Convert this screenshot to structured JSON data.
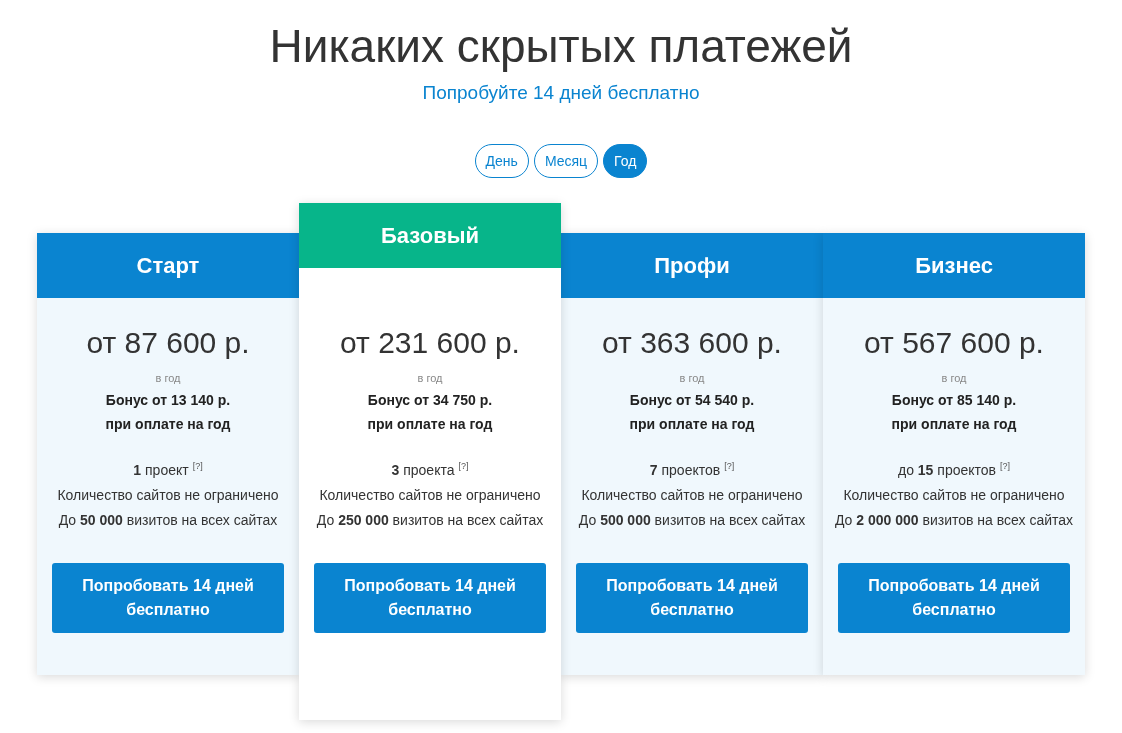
{
  "heading": "Никаких скрытых платежей",
  "subheading": "Попробуйте 14 дней бесплатно",
  "periods": [
    {
      "label": "День",
      "selected": false
    },
    {
      "label": "Месяц",
      "selected": false
    },
    {
      "label": "Год",
      "selected": true
    }
  ],
  "plans": [
    {
      "name": "Старт",
      "featured": false,
      "price": "от 87 600 р.",
      "period": "в год",
      "bonus": "Бонус от 13 140 р.",
      "bonus_note": "при оплате на год",
      "projects": "**1** проект",
      "help": "[?]",
      "sites": "Количество сайтов не ограничено",
      "visits": "До **50 000** визитов на всех сайтах",
      "button": "Попробовать 14 дней бесплатно"
    },
    {
      "name": "Базовый",
      "featured": true,
      "price": "от 231 600 р.",
      "period": "в год",
      "bonus": "Бонус от 34 750 р.",
      "bonus_note": "при оплате на год",
      "projects": "**3** проекта",
      "help": "[?]",
      "sites": "Количество сайтов не ограничено",
      "visits": "До **250 000** визитов на всех сайтах",
      "button": "Попробовать 14 дней бесплатно"
    },
    {
      "name": "Профи",
      "featured": false,
      "price": "от 363 600 р.",
      "period": "в год",
      "bonus": "Бонус от 54 540 р.",
      "bonus_note": "при оплате на год",
      "projects": "**7** проектов",
      "help": "[?]",
      "sites": "Количество сайтов не ограничено",
      "visits": "До **500 000** визитов на всех сайтах",
      "button": "Попробовать 14 дней бесплатно"
    },
    {
      "name": "Бизнес",
      "featured": false,
      "price": "от 567 600 р.",
      "period": "в год",
      "bonus": "Бонус от 85 140 р.",
      "bonus_note": "при оплате на год",
      "projects": "до **15** проектов",
      "help": "[?]",
      "sites": "Количество сайтов не ограничено",
      "visits": "До **2 000 000** визитов на всех сайтах",
      "button": "Попробовать 14 дней бесплатно"
    }
  ]
}
